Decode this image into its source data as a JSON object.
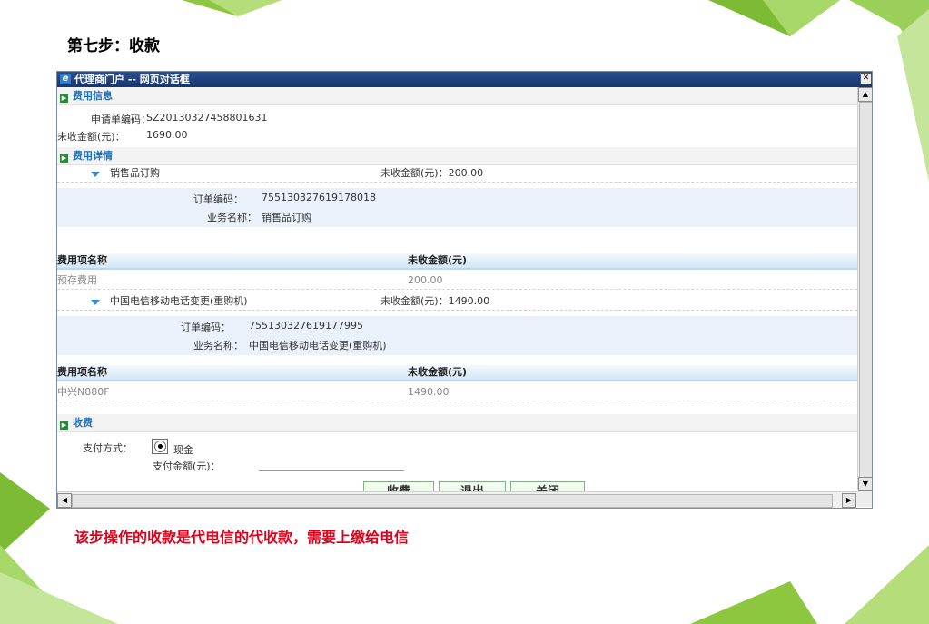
{
  "slide": {
    "step_title": "第七步：收款",
    "note": "该步操作的收款是代电信的代收款，需要上缴给电信"
  },
  "dialog": {
    "title": "代理商门户 -- 网页对话框",
    "sections": {
      "fee_info": "费用信息",
      "fee_detail": "费用详情",
      "collect": "收费"
    },
    "fee_info": {
      "order_no_label": "申请单编码：",
      "order_no_value": "SZ20130327458801631",
      "uncollected_label": "未收金额(元)：",
      "uncollected_value": "1690.00"
    },
    "orders": [
      {
        "name": "销售品订购",
        "amount_text": "未收金额(元)：200.00",
        "order_code_label": "订单编码：",
        "order_code": "755130327619178018",
        "biz_label": "业务名称：",
        "biz_name": "销售品订购",
        "col_item": "费用项名称",
        "col_amount": "未收金额(元)",
        "item": "预存费用",
        "item_amount": "200.00"
      },
      {
        "name": "中国电信移动电话变更(重购机)",
        "amount_text": "未收金额(元)：1490.00",
        "order_code_label": "订单编码：",
        "order_code": "755130327619177995",
        "biz_label": "业务名称：",
        "biz_name": "中国电信移动电话变更(重购机)",
        "col_item": "费用项名称",
        "col_amount": "未收金额(元)",
        "item": "中兴N880F",
        "item_amount": "1490.00"
      }
    ],
    "payment": {
      "method_label": "支付方式：",
      "method_value": "现金",
      "amount_label": "支付金额(元)："
    },
    "buttons": {
      "charge": "收费",
      "exit": "退出",
      "close": "关闭"
    }
  }
}
